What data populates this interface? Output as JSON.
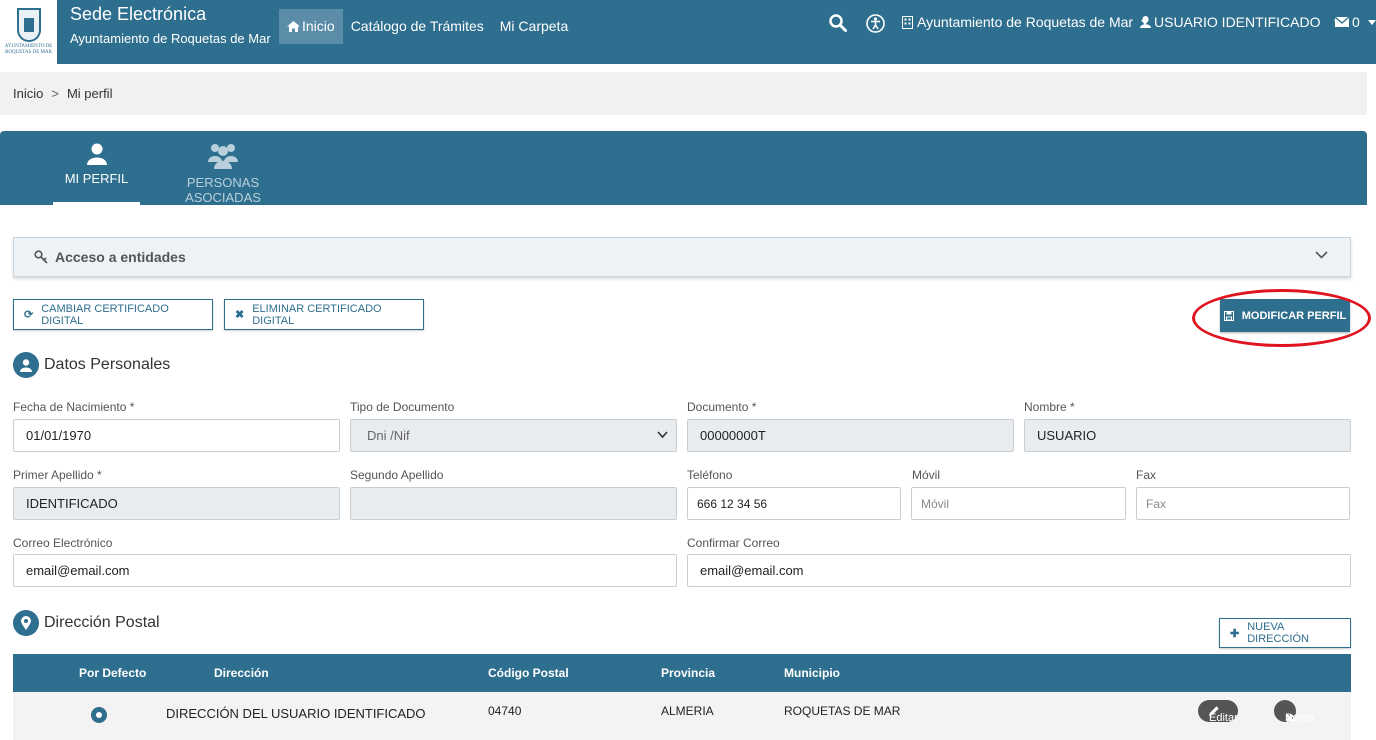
{
  "header": {
    "logo_text": "AYUNTAMIENTO DE ROQUETAS DE MAR",
    "title": "Sede Electrónica",
    "subtitle": "Ayuntamiento de Roquetas de Mar",
    "nav": [
      "Inicio",
      "Catálogo de Trámites",
      "Mi Carpeta"
    ],
    "entity": "Ayuntamiento de Roquetas de Mar",
    "user": "USUARIO IDENTIFICADO",
    "mail_count": "0"
  },
  "breadcrumb": {
    "home": "Inicio",
    "current": "Mi perfil",
    "separator": ">"
  },
  "tabs": {
    "profile": "MI PERFIL",
    "associated": "PERSONAS ASOCIADAS"
  },
  "accordion": {
    "label": "Acceso a entidades"
  },
  "buttons": {
    "change_cert": "CAMBIAR CERTIFICADO DIGITAL",
    "delete_cert": "ELIMINAR CERTIFICADO DIGITAL",
    "modify_profile": "MODIFICAR PERFIL",
    "new_address": "NUEVA DIRECCIÓN",
    "edit": "Editar",
    "delete": "Borrar"
  },
  "personal": {
    "title": "Datos Personales",
    "birth_label": "Fecha de Nacimiento *",
    "birth_value": "01/01/1970",
    "doc_type_label": "Tipo de Documento",
    "doc_type_value": "Dni /Nif",
    "doc_label": "Documento *",
    "doc_value": "00000000T",
    "name_label": "Nombre *",
    "name_value": "USUARIO",
    "surname1_label": "Primer Apellido *",
    "surname1_value": "IDENTIFICADO",
    "surname2_label": "Segundo Apellido",
    "surname2_value": "",
    "phone_label": "Teléfono",
    "phone_value": "666 12 34 56",
    "mobile_label": "Móvil",
    "mobile_placeholder": "Móvil",
    "fax_label": "Fax",
    "fax_placeholder": "Fax",
    "email_label": "Correo Electrónico",
    "email_value": "email@email.com",
    "email_confirm_label": "Confirmar Correo",
    "email_confirm_value": "email@email.com"
  },
  "address": {
    "title": "Dirección Postal",
    "columns": [
      "Por Defecto",
      "Dirección",
      "Código Postal",
      "Provincia",
      "Municipio"
    ],
    "rows": [
      {
        "default": true,
        "address": "DIRECCIÓN DEL USUARIO IDENTIFICADO",
        "postal_code": "04740",
        "province": "ALMERIA",
        "municipality": "ROQUETAS DE MAR"
      }
    ]
  },
  "colors": {
    "primary": "#2e6e8e",
    "highlight_ring": "#e0141e"
  }
}
